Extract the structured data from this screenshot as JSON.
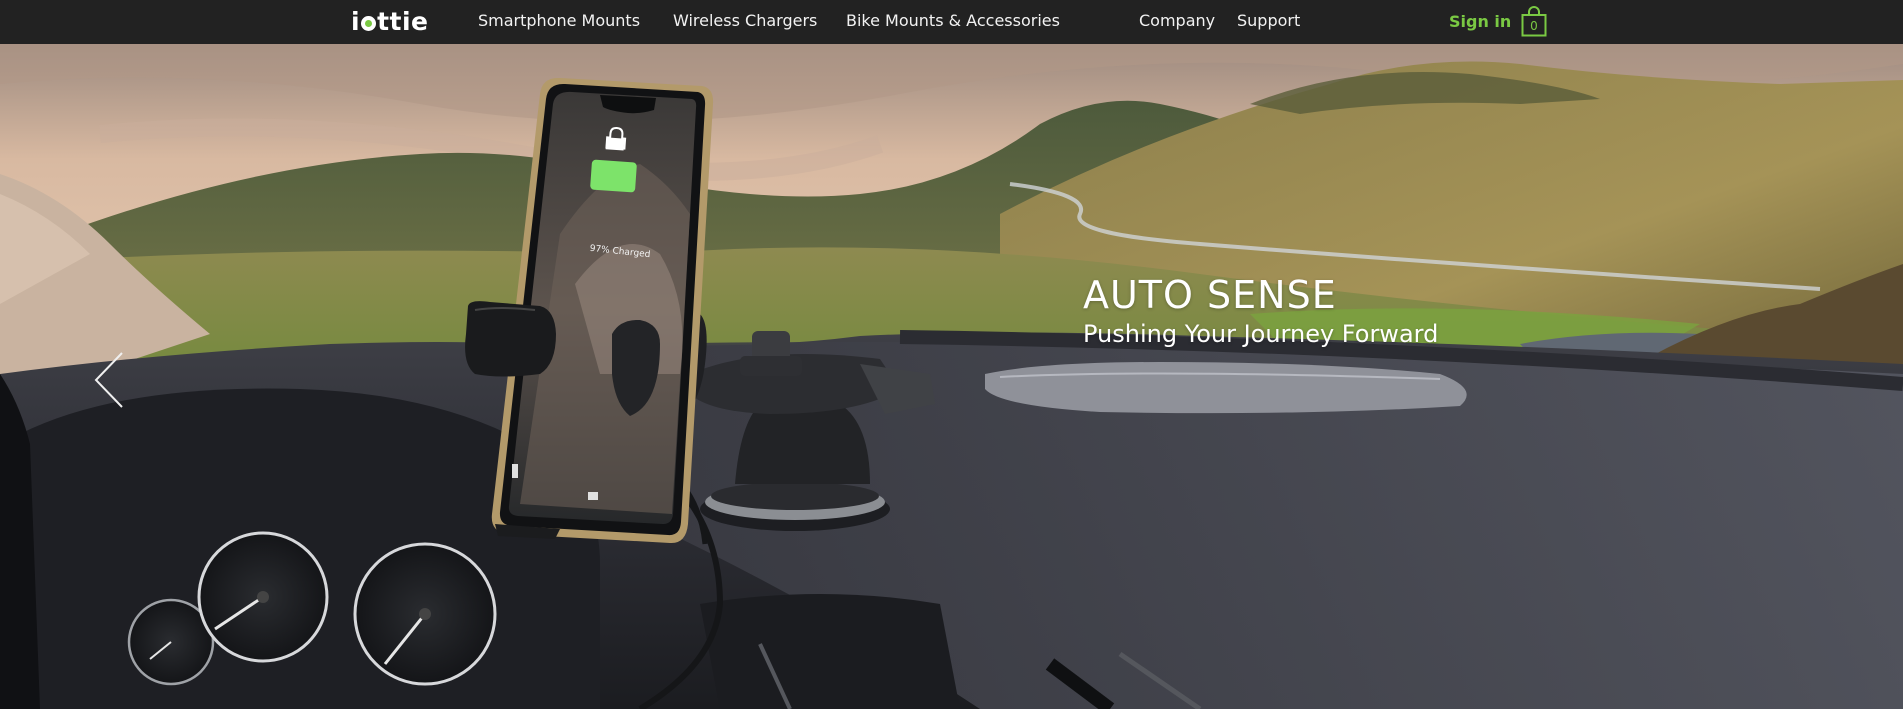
{
  "brand": {
    "logo_prefix": "i",
    "logo_suffix": "ttie"
  },
  "nav": {
    "primary": [
      {
        "label": "Smartphone Mounts"
      },
      {
        "label": "Wireless Chargers"
      },
      {
        "label": "Bike Mounts & Accessories"
      }
    ],
    "secondary": [
      {
        "label": "Company"
      },
      {
        "label": "Support"
      }
    ],
    "sign_in": "Sign in",
    "cart_count": "0",
    "cart_icon": "shopping-bag-icon"
  },
  "hero": {
    "title": "AUTO SENSE",
    "subtitle": "Pushing Your Journey Forward",
    "prev_icon": "chevron-left-icon",
    "phone_status": "97% Charged"
  },
  "colors": {
    "nav_bg": "#222222",
    "accent": "#7ac943",
    "text": "#ffffff"
  }
}
